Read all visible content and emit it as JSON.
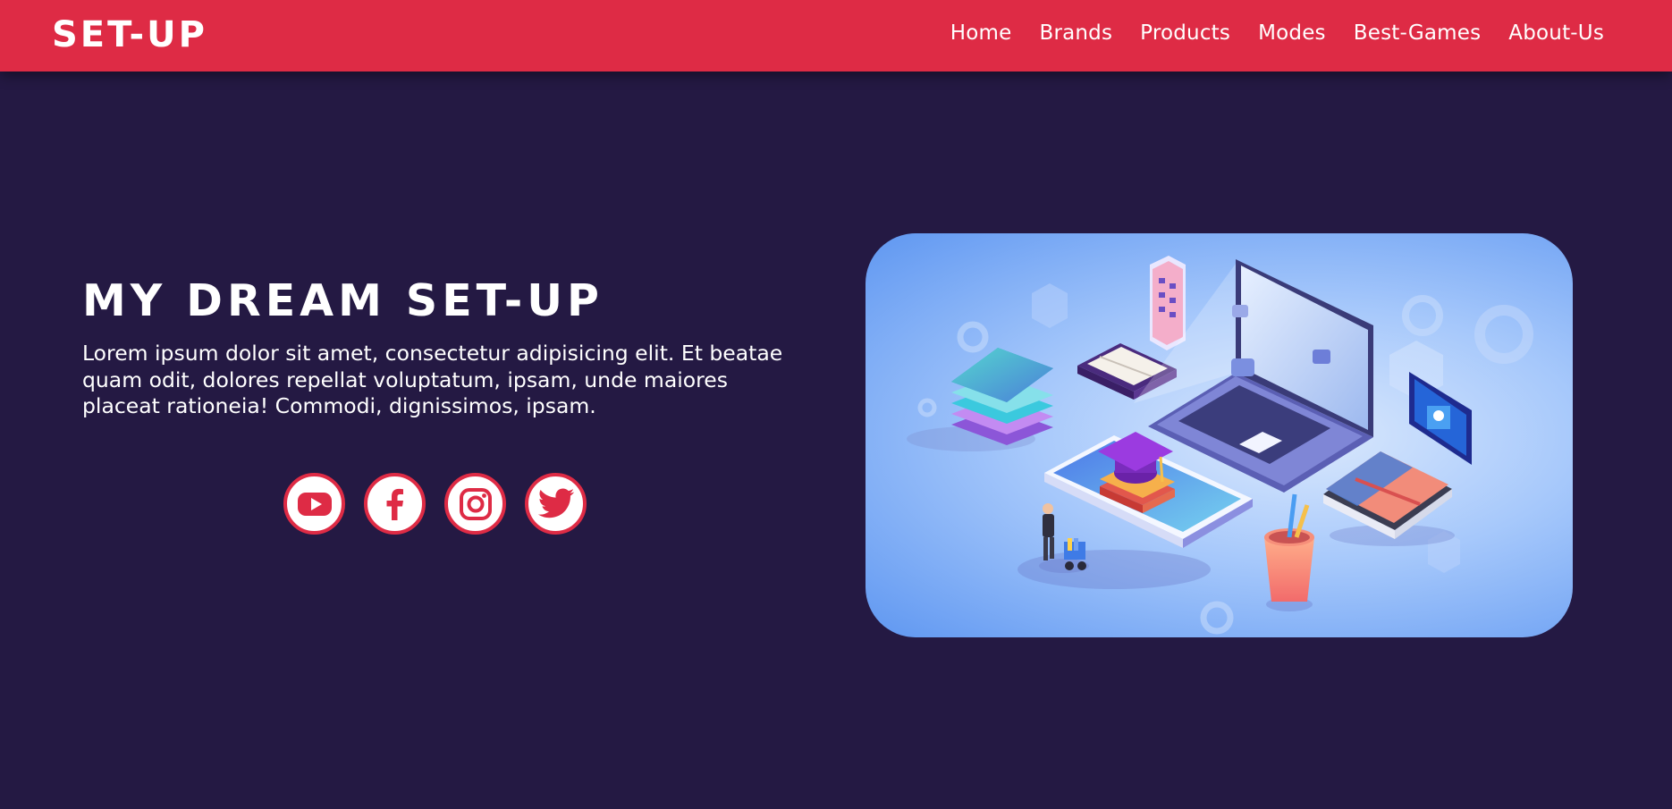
{
  "header": {
    "logo": "SET-UP",
    "nav": [
      {
        "label": "Home"
      },
      {
        "label": "Brands"
      },
      {
        "label": "Products"
      },
      {
        "label": "Modes"
      },
      {
        "label": "Best-Games"
      },
      {
        "label": "About-Us"
      }
    ]
  },
  "hero": {
    "title": "MY DREAM SET-UP",
    "description": "Lorem ipsum dolor sit amet, consectetur adipisicing elit. Et beatae quam odit, dolores repellat voluptatum, ipsam, unde maiores placeat rationeia! Commodi, dignissimos, ipsam.",
    "socials": [
      {
        "icon": "youtube-icon"
      },
      {
        "icon": "facebook-icon"
      },
      {
        "icon": "instagram-icon"
      },
      {
        "icon": "twitter-icon"
      }
    ],
    "illustration": "isometric-study-setup-illustration"
  },
  "colors": {
    "accent": "#de2b45",
    "background": "#241943",
    "text": "#ffffff"
  }
}
